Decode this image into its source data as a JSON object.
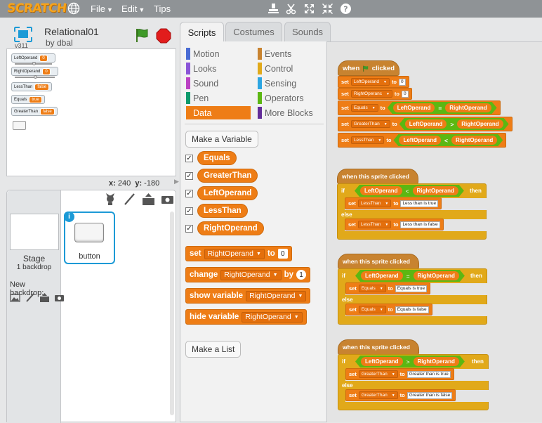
{
  "app": {
    "logo_text": "SCRATCH",
    "menu": [
      {
        "label": "File"
      },
      {
        "label": "Edit"
      },
      {
        "label": "Tips"
      }
    ]
  },
  "project": {
    "title": "Relational01",
    "author": "by dbal",
    "version": "v311"
  },
  "stage_monitors": [
    {
      "label": "LeftOperand",
      "value": "0"
    },
    {
      "label": "RightOperand",
      "value": "0"
    },
    {
      "label": "LessThan",
      "value": "false"
    },
    {
      "label": "Equals",
      "value": "true"
    },
    {
      "label": "GreaterThan",
      "value": "false"
    }
  ],
  "coords": {
    "x_label": "x:",
    "x": "240",
    "y_label": "y:",
    "y": "-180"
  },
  "sprite_pane": {
    "stage_label": "Stage",
    "backdrop_count": "1 backdrop",
    "new_backdrop": "New backdrop:",
    "sprite_name": "button",
    "info": "i"
  },
  "tabs": [
    {
      "label": "Scripts",
      "active": true
    },
    {
      "label": "Costumes",
      "active": false
    },
    {
      "label": "Sounds",
      "active": false
    }
  ],
  "categories": [
    {
      "label": "Motion",
      "color": "#4a6cd4"
    },
    {
      "label": "Looks",
      "color": "#8a55d7"
    },
    {
      "label": "Sound",
      "color": "#bb42c3"
    },
    {
      "label": "Pen",
      "color": "#0e9a6c"
    },
    {
      "label": "Data",
      "color": "#ee7d16",
      "active": true
    },
    {
      "label": "Events",
      "color": "#c88330"
    },
    {
      "label": "Control",
      "color": "#e1a91a"
    },
    {
      "label": "Sensing",
      "color": "#2ca5e2"
    },
    {
      "label": "Operators",
      "color": "#5cb712"
    },
    {
      "label": "More Blocks",
      "color": "#632d99"
    }
  ],
  "palette": {
    "make_variable": "Make a Variable",
    "make_list": "Make a List",
    "variables": [
      "Equals",
      "GreaterThan",
      "LeftOperand",
      "LessThan",
      "RightOperand"
    ],
    "check": "✓",
    "set_block": {
      "prefix": "set",
      "var": "RightOperand",
      "to": "to",
      "value": "0"
    },
    "change_block": {
      "prefix": "change",
      "var": "RightOperand",
      "by": "by",
      "value": "1"
    },
    "show_block": {
      "prefix": "show variable",
      "var": "RightOperand"
    },
    "hide_block": {
      "prefix": "hide variable",
      "var": "RightOperand"
    }
  },
  "scripts": {
    "flag_script": {
      "hat_when": "when",
      "hat_clicked": "clicked",
      "set": "set",
      "to": "to",
      "lines": [
        {
          "var": "LeftOperand",
          "value": "0"
        },
        {
          "var": "RightOperanc",
          "value": "0"
        },
        {
          "var": "Equals",
          "left": "LeftOperand",
          "op": "=",
          "right": "RightOperand"
        },
        {
          "var": "GreaterThan",
          "left": "LeftOperand",
          "op": ">",
          "right": "RightOperand"
        },
        {
          "var": "LessThan",
          "left": "LeftOperand",
          "op": "<",
          "right": "RightOperand"
        }
      ]
    },
    "sprite_clicked_label": "when this sprite clicked",
    "if_label": "if",
    "then_label": "then",
    "else_label": "else",
    "set_label": "set",
    "to_label": "to",
    "lessthan_script": {
      "left": "LeftOperand",
      "op": "<",
      "right": "RightOperand",
      "var": "LessThan",
      "true_text": "Less than is true",
      "false_text": "Less than is false"
    },
    "equals_script": {
      "left": "LeftOperand",
      "op": "=",
      "right": "RightOperand",
      "var": "Equals",
      "true_text": "Equals is true",
      "false_text": "Equals is false"
    },
    "greater_script": {
      "left": "LeftOperand",
      "op": ">",
      "right": "RightOperand",
      "var": "GreaterThan",
      "true_text": "Greater than is true",
      "false_text": "Greater than is false"
    }
  }
}
